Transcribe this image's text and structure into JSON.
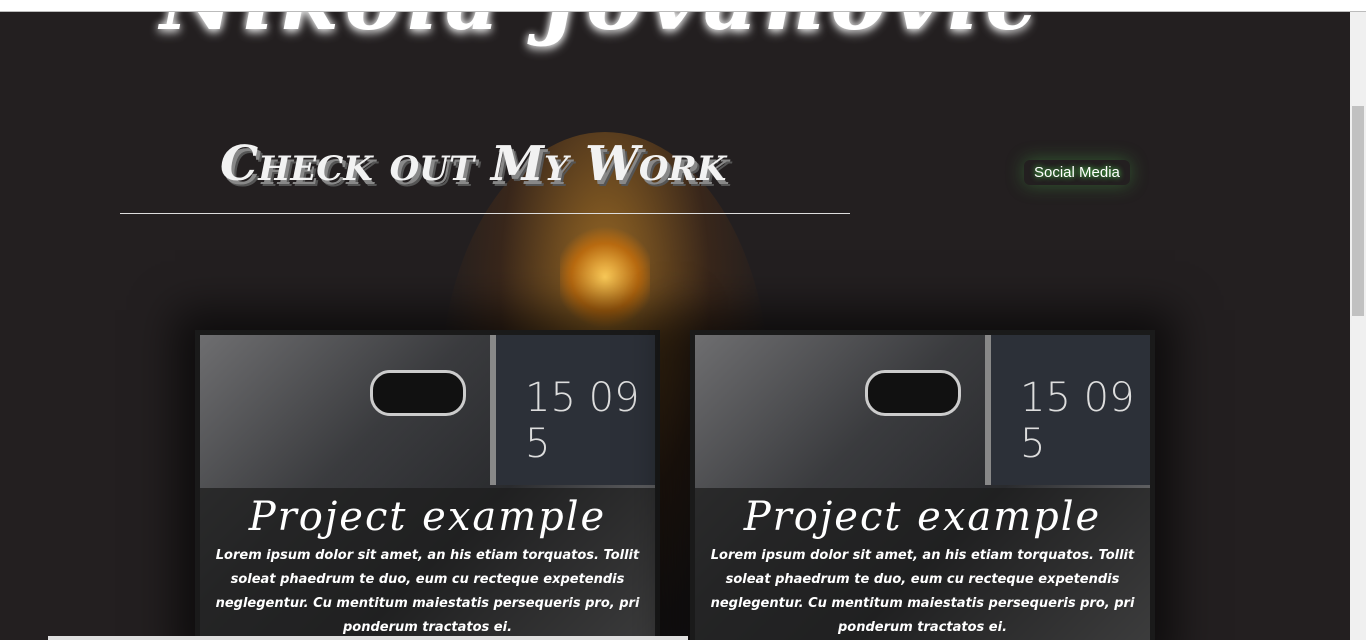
{
  "header": {
    "name": "Nikola Jovanovic",
    "section_title": "Check out My Work",
    "social_link": "Social Media"
  },
  "projects": [
    {
      "title": "Project example",
      "clock": "15 09 5",
      "description": "Lorem ipsum dolor sit amet, an his etiam torquatos. Tollit soleat phaedrum te duo, eum cu recteque expetendis neglegentur. Cu mentitum maiestatis persequeris pro, pri ponderum tractatos ei."
    },
    {
      "title": "Project example",
      "clock": "15 09 5",
      "description": "Lorem ipsum dolor sit amet, an his etiam torquatos. Tollit soleat phaedrum te duo, eum cu recteque expetendis neglegentur. Cu mentitum maiestatis persequeris pro, pri ponderum tractatos ei."
    }
  ]
}
